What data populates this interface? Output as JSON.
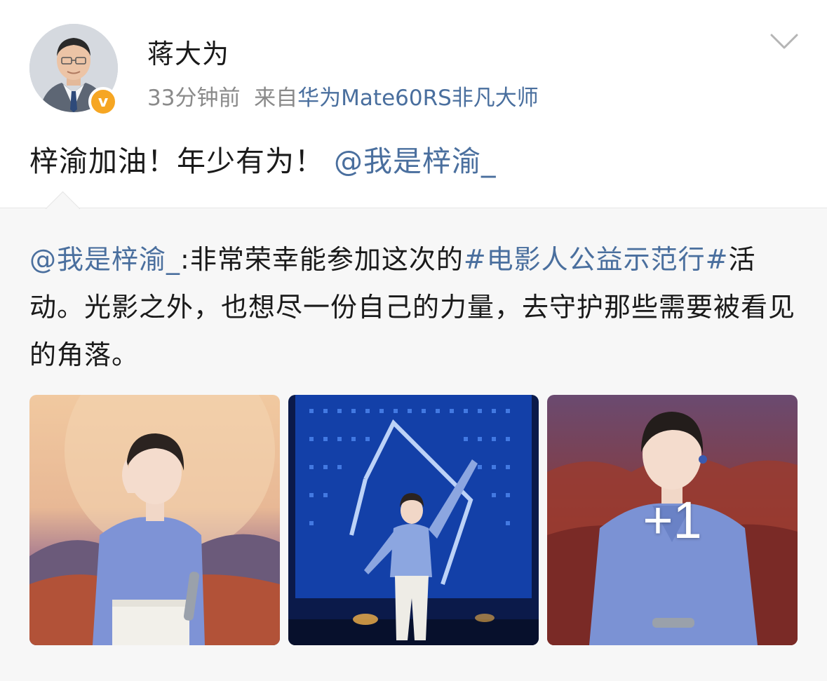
{
  "author": {
    "name": "蒋大为",
    "time": "33分钟前",
    "source_prefix": "来自",
    "source_device": "华为Mate60RS非凡大师",
    "verified_badge": "v"
  },
  "post": {
    "text": "梓渝加油！年少有为！",
    "mention": "@我是梓渝_"
  },
  "repost": {
    "author_mention": "@我是梓渝_",
    "text_part1": ":非常荣幸能参加这次的",
    "hashtag": "#电影人公益示范行#",
    "text_part2": "活动。光影之外，也想尽一份自己的力量，去守护那些需要被看见的角落。",
    "more_images_label": "+1"
  },
  "icons": {
    "menu": "chevron-down-icon",
    "verified": "verified-badge-icon"
  },
  "colors": {
    "link": "#4a6f9e",
    "meta": "#8a8a8a",
    "badge": "#f6a623",
    "repost_bg": "#f7f7f7"
  }
}
